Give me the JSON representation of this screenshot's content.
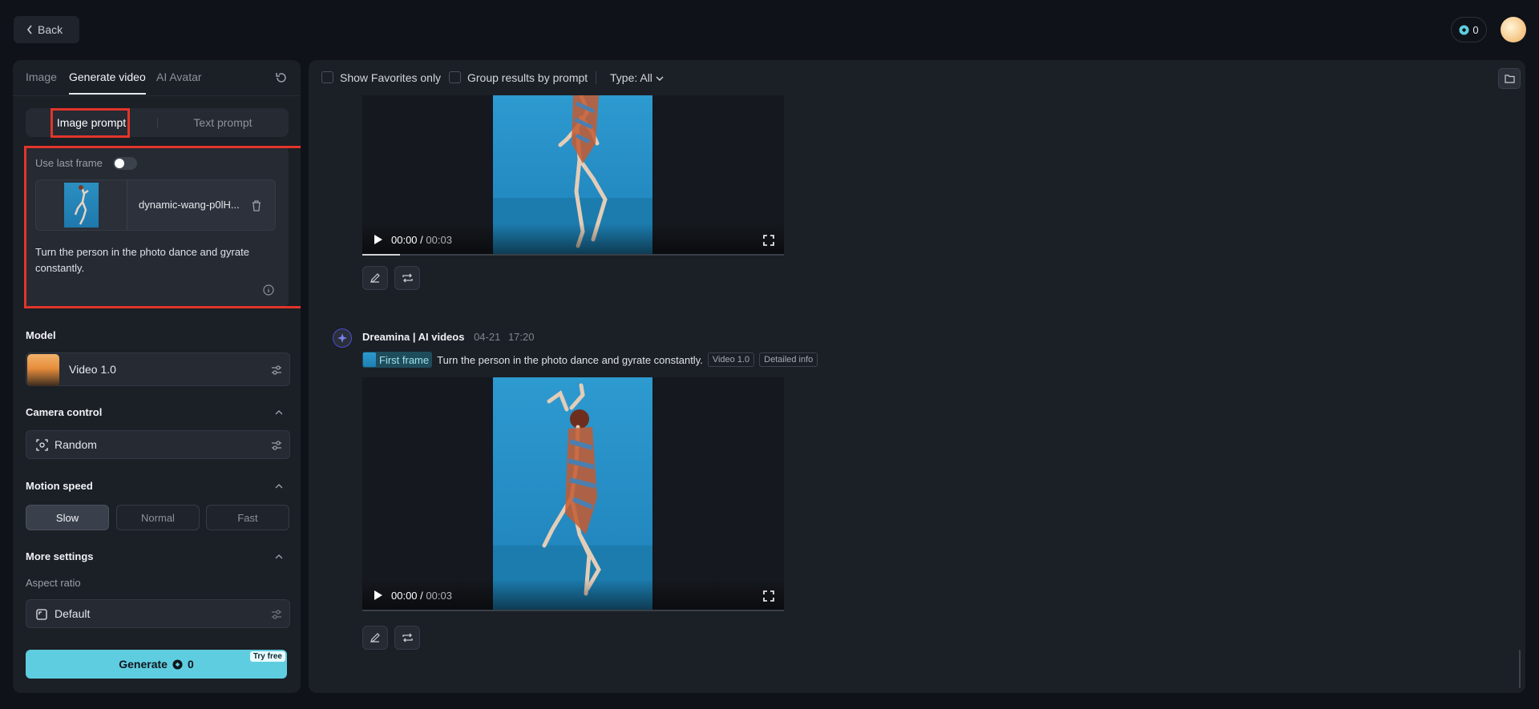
{
  "topbar": {
    "back_label": "Back",
    "credits": "0"
  },
  "tabs": [
    {
      "label": "Image"
    },
    {
      "label": "Generate video"
    },
    {
      "label": "AI Avatar"
    }
  ],
  "prompt_mode": {
    "image": "Image prompt",
    "text": "Text prompt"
  },
  "prompt_card": {
    "use_last_frame": "Use last frame",
    "file_name": "dynamic-wang-p0lH...",
    "prompt": "Turn the person in the photo dance and gyrate constantly."
  },
  "model": {
    "title": "Model",
    "name": "Video 1.0"
  },
  "camera": {
    "title": "Camera control",
    "value": "Random"
  },
  "motion": {
    "title": "Motion speed",
    "options": [
      "Slow",
      "Normal",
      "Fast"
    ],
    "selected": "Slow"
  },
  "more": {
    "title": "More settings",
    "aspect_label": "Aspect ratio",
    "aspect_value": "Default"
  },
  "generate": {
    "label": "Generate",
    "credits": "0",
    "badge": "Try free"
  },
  "filters": {
    "favorites": "Show Favorites only",
    "group": "Group results by prompt",
    "type": "Type: All"
  },
  "results": [
    {
      "time_current": "00:00",
      "time_total": "00:03",
      "progress": 0.09
    },
    {
      "author": "Dreamina | AI videos",
      "date": "04-21",
      "time": "17:20",
      "first_frame": "First frame",
      "prompt": "Turn the person in the photo dance and gyrate constantly.",
      "tags": [
        "Video 1.0",
        "Detailed info"
      ],
      "time_current": "00:00",
      "time_total": "00:03",
      "progress": 0.0
    }
  ],
  "colors": {
    "accent": "#5fcde0",
    "highlight": "#e2352a",
    "background": "#0f1218",
    "panel": "#1b1f26"
  }
}
